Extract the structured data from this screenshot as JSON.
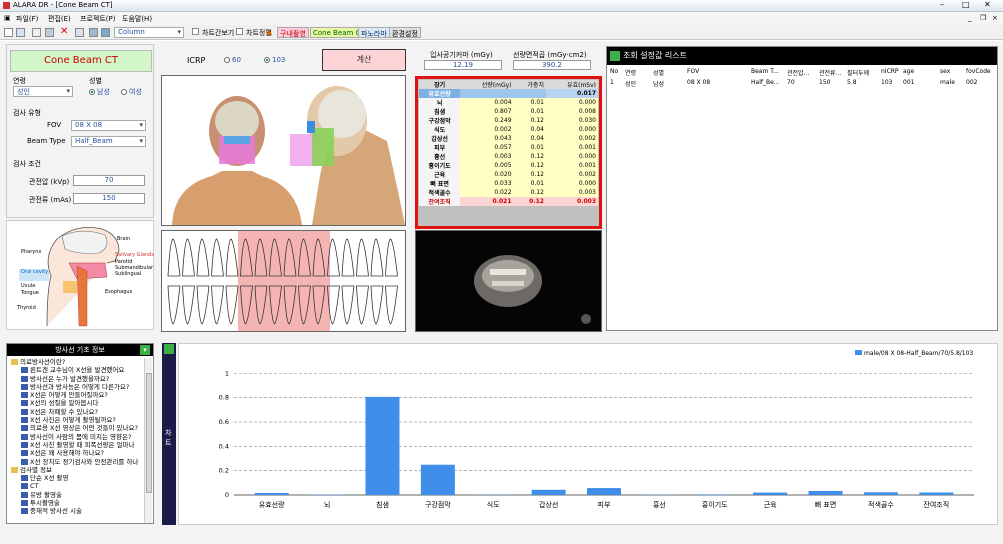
{
  "window": {
    "title": "ALARA DR - [Cone Beam CT]"
  },
  "menu": [
    "파일(F)",
    "편집(E)",
    "프로젝트(P)",
    "도움말(H)"
  ],
  "toolbar": {
    "dropdown": "Column",
    "chart_view": "차트간보기",
    "chart_settings": "차트정렬",
    "tag_intraoral": "구내촬영",
    "tag_cbct": "Cone Beam CT",
    "tag_pano": "파노라마",
    "tag_env": "환경설정"
  },
  "left": {
    "mode_title": "Cone Beam CT",
    "age_label": "연령",
    "age_value": "성인",
    "sex_label": "성별",
    "sex_male": "남성",
    "sex_female": "여성",
    "exam_type_label": "검사 유형",
    "fov_label": "FOV",
    "fov_value": "08 X 08",
    "beam_label": "Beam Type",
    "beam_value": "Half_Beam",
    "exam_cond_label": "검사 조건",
    "kvp_label": "관전압 (kVp)",
    "kvp_value": "70",
    "mas_label": "관전류 (mAs)",
    "mas_value": "150"
  },
  "anatomy": [
    "Brain",
    "Salivary Glands",
    "Parotid",
    "Submandibular",
    "Sublingual",
    "Pharynx",
    "Oral cavity",
    "Uvula",
    "Tongue",
    "Esophagus",
    "Thyroid"
  ],
  "icrp": {
    "label": "ICRP",
    "opt60": "60",
    "opt103": "103",
    "calc": "계산"
  },
  "dose": {
    "incident_label": "입사공기커마 (mGy)",
    "incident_value": "12.19",
    "dap_label": "선량면적곱 (mGy·cm2)",
    "dap_value": "390.2"
  },
  "organ_table": {
    "headers": [
      "장기",
      "선량(mGy)",
      "가중치",
      "유효(mSv)"
    ],
    "effective": {
      "name": "유효선량",
      "value": "0.017"
    },
    "rows": [
      [
        "뇌",
        "0.004",
        "0.01",
        "0.000"
      ],
      [
        "침샘",
        "0.807",
        "0.01",
        "0.008"
      ],
      [
        "구강점막",
        "0.249",
        "0.12",
        "0.030"
      ],
      [
        "식도",
        "0.002",
        "0.04",
        "0.000"
      ],
      [
        "갑상선",
        "0.043",
        "0.04",
        "0.002"
      ],
      [
        "피부",
        "0.057",
        "0.01",
        "0.001"
      ],
      [
        "흉선",
        "0.003",
        "0.12",
        "0.000"
      ],
      [
        "흉이기도",
        "0.005",
        "0.12",
        "0.001"
      ],
      [
        "근육",
        "0.020",
        "0.12",
        "0.002"
      ],
      [
        "뼈 표면",
        "0.033",
        "0.01",
        "0.000"
      ],
      [
        "적색골수",
        "0.022",
        "0.12",
        "0.003"
      ],
      [
        "잔여조직",
        "0.021",
        "0.12",
        "0.003"
      ]
    ]
  },
  "history": {
    "title": "조회 설정값 리스트",
    "headers": [
      "No",
      "연령",
      "성별",
      "FOV",
      "Beam T...",
      "관전압...",
      "관전류...",
      "필터두께",
      "nICRP",
      "age",
      "sex",
      "fovCode"
    ],
    "row": [
      "1",
      "성인",
      "남성",
      "08 X 08",
      "Half_Be...",
      "70",
      "150",
      "5.8",
      "103",
      "001",
      "male",
      "002"
    ]
  },
  "info": {
    "title": "방사선 기초 정보",
    "items": [
      {
        "t": "f",
        "s": "의료방사선이란?"
      },
      {
        "t": "d",
        "s": "뢴트겐 교수님이 X선을 발견했어요"
      },
      {
        "t": "d",
        "s": "방사선은 누가 발견했을까요?"
      },
      {
        "t": "d",
        "s": "방사선과 방사능은 어떻게 다른가요?"
      },
      {
        "t": "d",
        "s": "X선은 어떻게 만들어질까요?"
      },
      {
        "t": "d",
        "s": "X선의 성질을 알아봅시다"
      },
      {
        "t": "d",
        "s": "X선은 차폐할 수 있나요?"
      },
      {
        "t": "d",
        "s": "X선 사진은 어떻게 촬영될까요?"
      },
      {
        "t": "d",
        "s": "의료용 X선 영상은 어떤 것들이 있나요?"
      },
      {
        "t": "d",
        "s": "방사선이 사람의 몸에 미치는 영향은?"
      },
      {
        "t": "d",
        "s": "X선 사진 촬영할 때 피폭선량은 얼마나"
      },
      {
        "t": "d",
        "s": "X선은 왜 사용해야 하나요?"
      },
      {
        "t": "d",
        "s": "X선 장치도 정기검사와 안전관리를 하나"
      },
      {
        "t": "f",
        "s": "검사별 정보"
      },
      {
        "t": "d",
        "s": "단순 X선 촬영"
      },
      {
        "t": "d",
        "s": "CT"
      },
      {
        "t": "d",
        "s": "유방 촬영술"
      },
      {
        "t": "d",
        "s": "투시촬영술"
      },
      {
        "t": "d",
        "s": "중재적 방사선 시술"
      }
    ]
  },
  "chart_side_label": "차트",
  "chart_data": {
    "type": "bar",
    "categories": [
      "유효선량",
      "뇌",
      "침샘",
      "구강점막",
      "식도",
      "갑상선",
      "피부",
      "흉선",
      "흉이기도",
      "근육",
      "뼈 표면",
      "적색골수",
      "잔여조직"
    ],
    "series": [
      {
        "name": "male/08 X 08-Half_Beam/70/5.8/103",
        "values": [
          0.017,
          0.004,
          0.807,
          0.249,
          0.002,
          0.043,
          0.057,
          0.003,
          0.005,
          0.02,
          0.033,
          0.022,
          0.021
        ]
      }
    ],
    "ylim": [
      0,
      1
    ],
    "yticks": [
      "0",
      "0.2",
      "0.4",
      "0.6",
      "0.8",
      "1"
    ],
    "color": "#3f8fea",
    "grid": true,
    "legend": "top-right"
  }
}
